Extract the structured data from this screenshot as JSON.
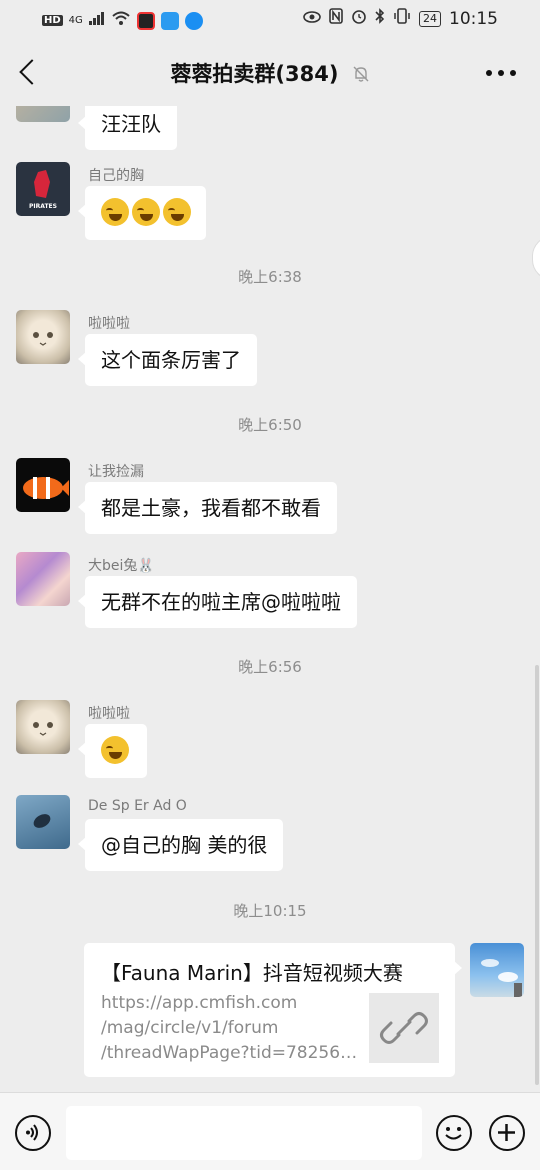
{
  "status_bar": {
    "network": "4G",
    "hd": "HD",
    "battery": "24",
    "time": "10:15"
  },
  "header": {
    "title": "蓉蓉拍卖群(384)"
  },
  "messages": [
    {
      "type": "text",
      "sender": "",
      "text": "汪汪队"
    },
    {
      "type": "emoji",
      "sender": "自己的胸",
      "emoji_count": 3
    },
    {
      "type": "time",
      "text": "晚上6:38"
    },
    {
      "type": "text",
      "sender": "啦啦啦",
      "text": "这个面条厉害了"
    },
    {
      "type": "time",
      "text": "晚上6:50"
    },
    {
      "type": "text",
      "sender": "让我捡漏",
      "text": "都是土豪，我看都不敢看"
    },
    {
      "type": "text",
      "sender": "大bei兔🐰",
      "text": "无群不在的啦主席@啦啦啦"
    },
    {
      "type": "time",
      "text": "晚上6:56"
    },
    {
      "type": "emoji",
      "sender": "啦啦啦",
      "emoji_count": 1
    },
    {
      "type": "text",
      "sender": "De Sp Er Ad O",
      "text": "@自己的胸  美的很"
    },
    {
      "type": "time",
      "text": "晚上10:15"
    }
  ],
  "link_card": {
    "title": "【Fauna Marin】抖音短视频大赛",
    "url_lines": [
      "https://app.cmfish.com",
      "/mag/circle/v1/forum",
      "/threadWapPage?tid=78256…"
    ]
  },
  "input": {
    "placeholder": ""
  },
  "colors": {
    "background": "#ededed",
    "bubble": "#ffffff",
    "nickname": "#7a7a7a"
  }
}
